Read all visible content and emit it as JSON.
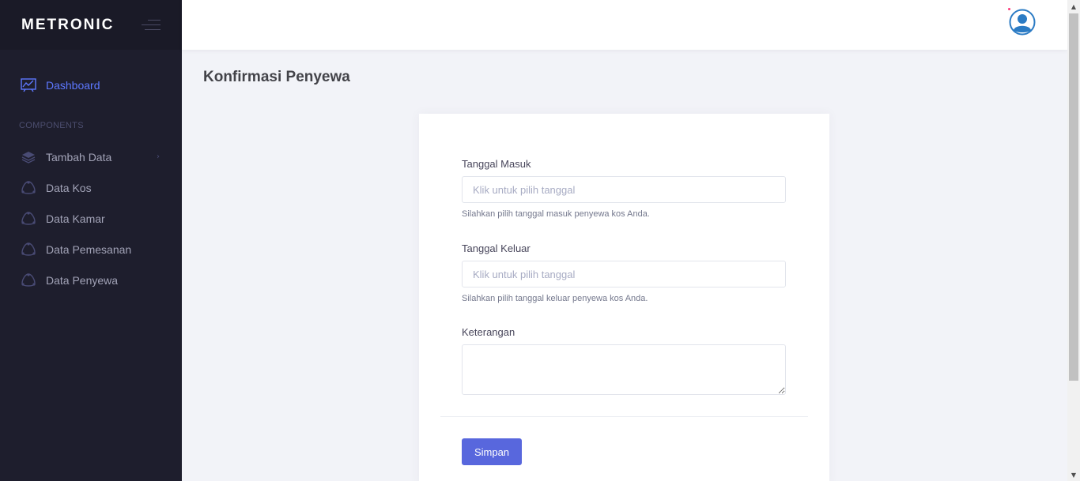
{
  "brand": {
    "logo_text": "METRONIC"
  },
  "sidebar": {
    "items": [
      {
        "label": "Dashboard",
        "icon": "chart-icon",
        "active": true
      },
      {
        "label": "Tambah Data",
        "icon": "layers-icon",
        "has_submenu": true
      },
      {
        "label": "Data Kos",
        "icon": "triangle-icon"
      },
      {
        "label": "Data Kamar",
        "icon": "triangle-icon"
      },
      {
        "label": "Data Pemesanan",
        "icon": "triangle-icon"
      },
      {
        "label": "Data Penyewa",
        "icon": "triangle-icon"
      }
    ],
    "section_label": "COMPONENTS"
  },
  "header": {
    "avatar_icon": "user-avatar-icon"
  },
  "page": {
    "title": "Konfirmasi Penyewa"
  },
  "form": {
    "tanggal_masuk": {
      "label": "Tanggal Masuk",
      "placeholder": "Klik untuk pilih tanggal",
      "value": "",
      "help": "Silahkan pilih tanggal masuk penyewa kos Anda."
    },
    "tanggal_keluar": {
      "label": "Tanggal Keluar",
      "placeholder": "Klik untuk pilih tanggal",
      "value": "",
      "help": "Silahkan pilih tanggal keluar penyewa kos Anda."
    },
    "keterangan": {
      "label": "Keterangan",
      "value": ""
    },
    "submit_label": "Simpan"
  },
  "colors": {
    "sidebar_bg": "#1e1e2d",
    "accent": "#5d78ff",
    "button": "#5867dd"
  }
}
